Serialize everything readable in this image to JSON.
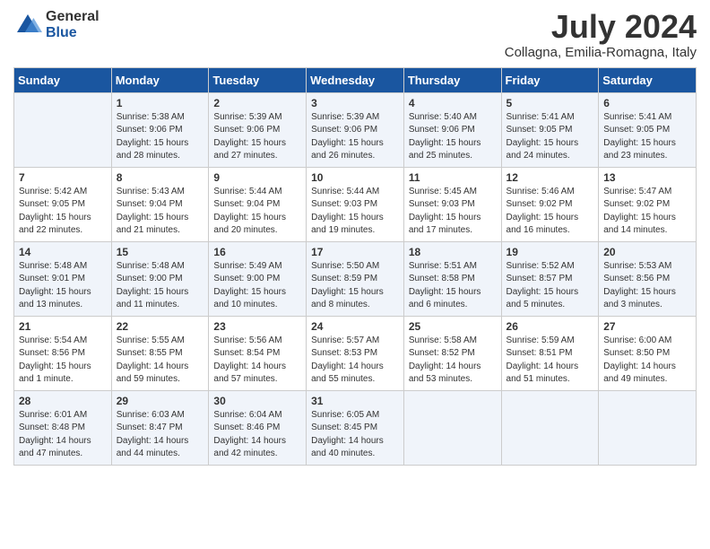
{
  "logo": {
    "general": "General",
    "blue": "Blue"
  },
  "title": "July 2024",
  "subtitle": "Collagna, Emilia-Romagna, Italy",
  "days_of_week": [
    "Sunday",
    "Monday",
    "Tuesday",
    "Wednesday",
    "Thursday",
    "Friday",
    "Saturday"
  ],
  "weeks": [
    [
      {
        "num": "",
        "info": ""
      },
      {
        "num": "1",
        "info": "Sunrise: 5:38 AM\nSunset: 9:06 PM\nDaylight: 15 hours\nand 28 minutes."
      },
      {
        "num": "2",
        "info": "Sunrise: 5:39 AM\nSunset: 9:06 PM\nDaylight: 15 hours\nand 27 minutes."
      },
      {
        "num": "3",
        "info": "Sunrise: 5:39 AM\nSunset: 9:06 PM\nDaylight: 15 hours\nand 26 minutes."
      },
      {
        "num": "4",
        "info": "Sunrise: 5:40 AM\nSunset: 9:06 PM\nDaylight: 15 hours\nand 25 minutes."
      },
      {
        "num": "5",
        "info": "Sunrise: 5:41 AM\nSunset: 9:05 PM\nDaylight: 15 hours\nand 24 minutes."
      },
      {
        "num": "6",
        "info": "Sunrise: 5:41 AM\nSunset: 9:05 PM\nDaylight: 15 hours\nand 23 minutes."
      }
    ],
    [
      {
        "num": "7",
        "info": "Sunrise: 5:42 AM\nSunset: 9:05 PM\nDaylight: 15 hours\nand 22 minutes."
      },
      {
        "num": "8",
        "info": "Sunrise: 5:43 AM\nSunset: 9:04 PM\nDaylight: 15 hours\nand 21 minutes."
      },
      {
        "num": "9",
        "info": "Sunrise: 5:44 AM\nSunset: 9:04 PM\nDaylight: 15 hours\nand 20 minutes."
      },
      {
        "num": "10",
        "info": "Sunrise: 5:44 AM\nSunset: 9:03 PM\nDaylight: 15 hours\nand 19 minutes."
      },
      {
        "num": "11",
        "info": "Sunrise: 5:45 AM\nSunset: 9:03 PM\nDaylight: 15 hours\nand 17 minutes."
      },
      {
        "num": "12",
        "info": "Sunrise: 5:46 AM\nSunset: 9:02 PM\nDaylight: 15 hours\nand 16 minutes."
      },
      {
        "num": "13",
        "info": "Sunrise: 5:47 AM\nSunset: 9:02 PM\nDaylight: 15 hours\nand 14 minutes."
      }
    ],
    [
      {
        "num": "14",
        "info": "Sunrise: 5:48 AM\nSunset: 9:01 PM\nDaylight: 15 hours\nand 13 minutes."
      },
      {
        "num": "15",
        "info": "Sunrise: 5:48 AM\nSunset: 9:00 PM\nDaylight: 15 hours\nand 11 minutes."
      },
      {
        "num": "16",
        "info": "Sunrise: 5:49 AM\nSunset: 9:00 PM\nDaylight: 15 hours\nand 10 minutes."
      },
      {
        "num": "17",
        "info": "Sunrise: 5:50 AM\nSunset: 8:59 PM\nDaylight: 15 hours\nand 8 minutes."
      },
      {
        "num": "18",
        "info": "Sunrise: 5:51 AM\nSunset: 8:58 PM\nDaylight: 15 hours\nand 6 minutes."
      },
      {
        "num": "19",
        "info": "Sunrise: 5:52 AM\nSunset: 8:57 PM\nDaylight: 15 hours\nand 5 minutes."
      },
      {
        "num": "20",
        "info": "Sunrise: 5:53 AM\nSunset: 8:56 PM\nDaylight: 15 hours\nand 3 minutes."
      }
    ],
    [
      {
        "num": "21",
        "info": "Sunrise: 5:54 AM\nSunset: 8:56 PM\nDaylight: 15 hours\nand 1 minute."
      },
      {
        "num": "22",
        "info": "Sunrise: 5:55 AM\nSunset: 8:55 PM\nDaylight: 14 hours\nand 59 minutes."
      },
      {
        "num": "23",
        "info": "Sunrise: 5:56 AM\nSunset: 8:54 PM\nDaylight: 14 hours\nand 57 minutes."
      },
      {
        "num": "24",
        "info": "Sunrise: 5:57 AM\nSunset: 8:53 PM\nDaylight: 14 hours\nand 55 minutes."
      },
      {
        "num": "25",
        "info": "Sunrise: 5:58 AM\nSunset: 8:52 PM\nDaylight: 14 hours\nand 53 minutes."
      },
      {
        "num": "26",
        "info": "Sunrise: 5:59 AM\nSunset: 8:51 PM\nDaylight: 14 hours\nand 51 minutes."
      },
      {
        "num": "27",
        "info": "Sunrise: 6:00 AM\nSunset: 8:50 PM\nDaylight: 14 hours\nand 49 minutes."
      }
    ],
    [
      {
        "num": "28",
        "info": "Sunrise: 6:01 AM\nSunset: 8:48 PM\nDaylight: 14 hours\nand 47 minutes."
      },
      {
        "num": "29",
        "info": "Sunrise: 6:03 AM\nSunset: 8:47 PM\nDaylight: 14 hours\nand 44 minutes."
      },
      {
        "num": "30",
        "info": "Sunrise: 6:04 AM\nSunset: 8:46 PM\nDaylight: 14 hours\nand 42 minutes."
      },
      {
        "num": "31",
        "info": "Sunrise: 6:05 AM\nSunset: 8:45 PM\nDaylight: 14 hours\nand 40 minutes."
      },
      {
        "num": "",
        "info": ""
      },
      {
        "num": "",
        "info": ""
      },
      {
        "num": "",
        "info": ""
      }
    ]
  ]
}
